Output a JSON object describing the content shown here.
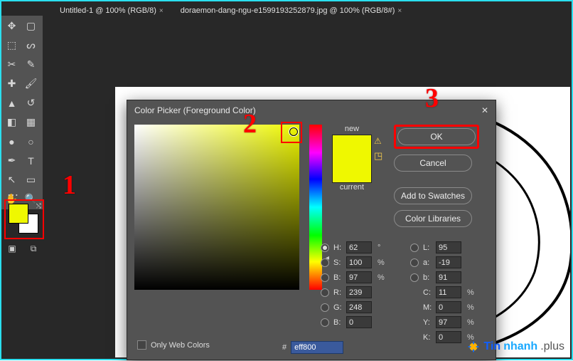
{
  "tabs": {
    "untitled": "Untitled-1 @ 100% (RGB/8)",
    "active": "doraemon-dang-ngu-e1599193252879.jpg @ 100% (RGB/8#)"
  },
  "tools": {
    "names": [
      "move",
      "artboard",
      "rect-marquee",
      "lasso",
      "crop",
      "eyedropper",
      "heal",
      "brush",
      "clone",
      "history-brush",
      "eraser",
      "gradient",
      "blur",
      "dodge",
      "pen",
      "type",
      "path-select",
      "rectangle",
      "hand",
      "zoom"
    ]
  },
  "fgbg": {
    "fg": "#eff800",
    "bg": "#ffffff"
  },
  "dialog": {
    "title": "Color Picker (Foreground Color)",
    "preview": {
      "new_label": "new",
      "current_label": "current"
    },
    "buttons": {
      "ok": "OK",
      "cancel": "Cancel",
      "add": "Add to Swatches",
      "libs": "Color Libraries"
    },
    "fields": {
      "H": {
        "value": "62",
        "unit": "°"
      },
      "S": {
        "value": "100",
        "unit": "%"
      },
      "B": {
        "value": "97",
        "unit": "%"
      },
      "R": {
        "value": "239"
      },
      "G": {
        "value": "248"
      },
      "Bch": {
        "value": "0"
      },
      "L": {
        "value": "95"
      },
      "a": {
        "value": "-19"
      },
      "b": {
        "value": "91"
      },
      "C": {
        "value": "11",
        "unit": "%"
      },
      "M": {
        "value": "0",
        "unit": "%"
      },
      "Y": {
        "value": "97",
        "unit": "%"
      },
      "K": {
        "value": "0",
        "unit": "%"
      }
    },
    "hex": {
      "label": "#",
      "value": "eff800"
    },
    "only_web": "Only Web Colors"
  },
  "annotations": {
    "a1": "1",
    "a2": "2",
    "a3": "3"
  },
  "watermark": {
    "p1": "Tin",
    "p2": "nhanh",
    "p3": ".plus"
  }
}
